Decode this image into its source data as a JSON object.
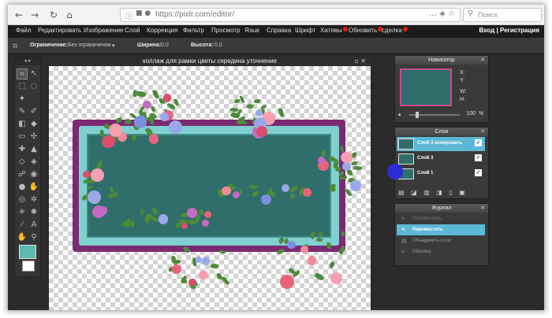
{
  "browser": {
    "url": "https://pixlr.com/editor/",
    "search_placeholder": "Поиск"
  },
  "menu": {
    "items": [
      "Файл",
      "Редактировать",
      "Изображение",
      "Слой",
      "Коррекция",
      "Фильтр",
      "Просмотр",
      "Язык",
      "Справка",
      "Шрифт",
      "Хатявы",
      "Обновить",
      "сделка"
    ],
    "auth": "Вход | Регистрация"
  },
  "options": {
    "limit_label": "Ограничение:",
    "limit_value": "Без ограничения",
    "width_label": "Ширина:",
    "width_value": "0.0",
    "height_label": "Высота:",
    "height_value": "0.0"
  },
  "document": {
    "title": "коллаж для рамки цветы середина уточнение",
    "controls": "▫ ✕"
  },
  "navigator": {
    "title": "Навигатор",
    "x_label": "X:",
    "y_label": "Y:",
    "w_label": "W:",
    "h_label": "H:",
    "zoom_value": "100",
    "zoom_unit": "%"
  },
  "layers": {
    "title": "Слои",
    "items": [
      {
        "name": "Слой 3 копировать",
        "visible": true
      },
      {
        "name": "Слой 3",
        "visible": true
      },
      {
        "name": "Слой 1",
        "visible": true
      }
    ]
  },
  "history": {
    "title": "Журнал",
    "items": [
      "Переместить",
      "Переместить",
      "Объединить слои",
      "Обрезка"
    ]
  },
  "colors": {
    "accent": "#5cb8d6",
    "primary_swatch": "#5fb9b3",
    "frame_purple": "#7b2a72",
    "frame_teal": "#2f6e6a"
  }
}
